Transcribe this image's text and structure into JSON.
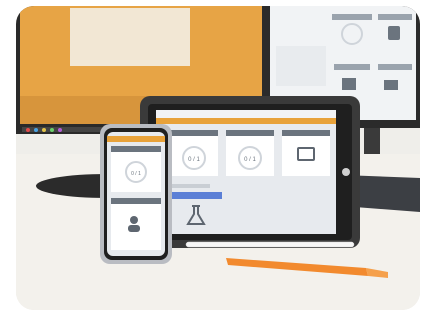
{
  "scene": {
    "description_visible_text": false,
    "colors": {
      "wall": "#efeeea",
      "desk": "#f3f1ec",
      "accent": "#e8a23a",
      "monitor_frame": "#2b2b2b",
      "pen_orange": "#f28a2e",
      "screen_bg": "#e7eaee"
    }
  },
  "tablet": {
    "cards": [
      {
        "label": "",
        "value": "0 / 1"
      },
      {
        "label": "",
        "value": "0 / 1"
      },
      {
        "label": "",
        "value": ""
      }
    ],
    "link_label": ""
  },
  "phone": {
    "card1_value": "0 / 1"
  }
}
